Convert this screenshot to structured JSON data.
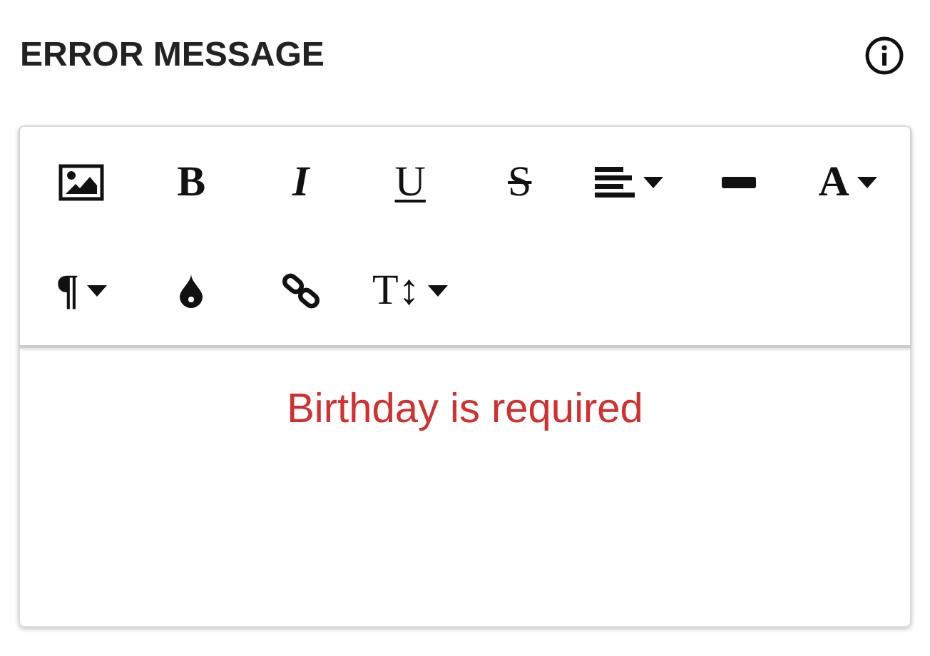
{
  "header": {
    "title": "ERROR MESSAGE"
  },
  "toolbar": [
    {
      "kind": "image",
      "dropdown": false
    },
    {
      "kind": "bold",
      "glyph": "B",
      "dropdown": false
    },
    {
      "kind": "italic",
      "glyph": "I",
      "dropdown": false
    },
    {
      "kind": "underline",
      "glyph": "U",
      "dropdown": false
    },
    {
      "kind": "strike",
      "glyph": "S",
      "dropdown": false
    },
    {
      "kind": "align",
      "dropdown": true
    },
    {
      "kind": "rule",
      "dropdown": false
    },
    {
      "kind": "font",
      "glyph": "A",
      "dropdown": true
    },
    {
      "kind": "paragraph",
      "glyph": "¶",
      "dropdown": true
    },
    {
      "kind": "drop",
      "dropdown": false
    },
    {
      "kind": "link",
      "dropdown": false
    },
    {
      "kind": "size",
      "glyph": "T↕",
      "dropdown": true
    }
  ],
  "editor": {
    "text": "Birthday is required"
  }
}
